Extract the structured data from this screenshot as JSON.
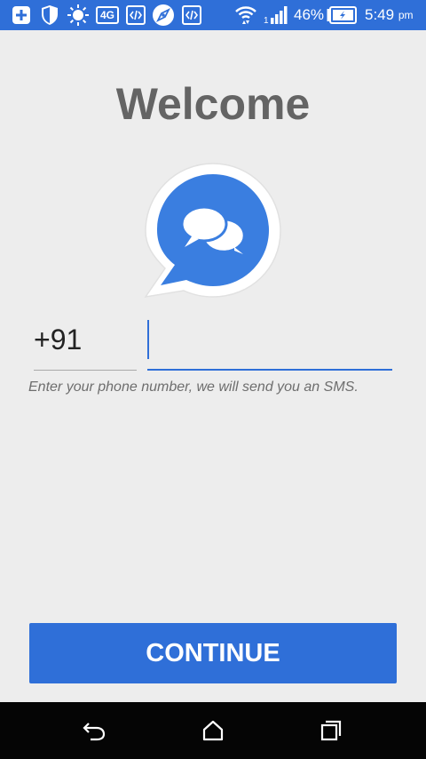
{
  "status_bar": {
    "battery_percent": "46%",
    "time": "5:49",
    "time_suffix": "pm",
    "network_badge": "4G",
    "icons": [
      "add-icon",
      "shield-icon",
      "brightness-icon",
      "network-4g-icon",
      "code-icon",
      "compass-icon",
      "code-icon",
      "wifi-icon",
      "signal-icon",
      "battery-icon"
    ]
  },
  "main": {
    "title": "Welcome",
    "country_code": "+91",
    "phone_value": "",
    "hint": "Enter your phone number, we will send you an SMS.",
    "continue_label": "CONTINUE"
  },
  "nav_bar": {
    "icons": [
      "back-icon",
      "home-icon",
      "recents-icon"
    ]
  },
  "colors": {
    "accent": "#2f6fd8",
    "background": "#ededed",
    "title": "#646464",
    "hint": "#6e6e6e"
  }
}
